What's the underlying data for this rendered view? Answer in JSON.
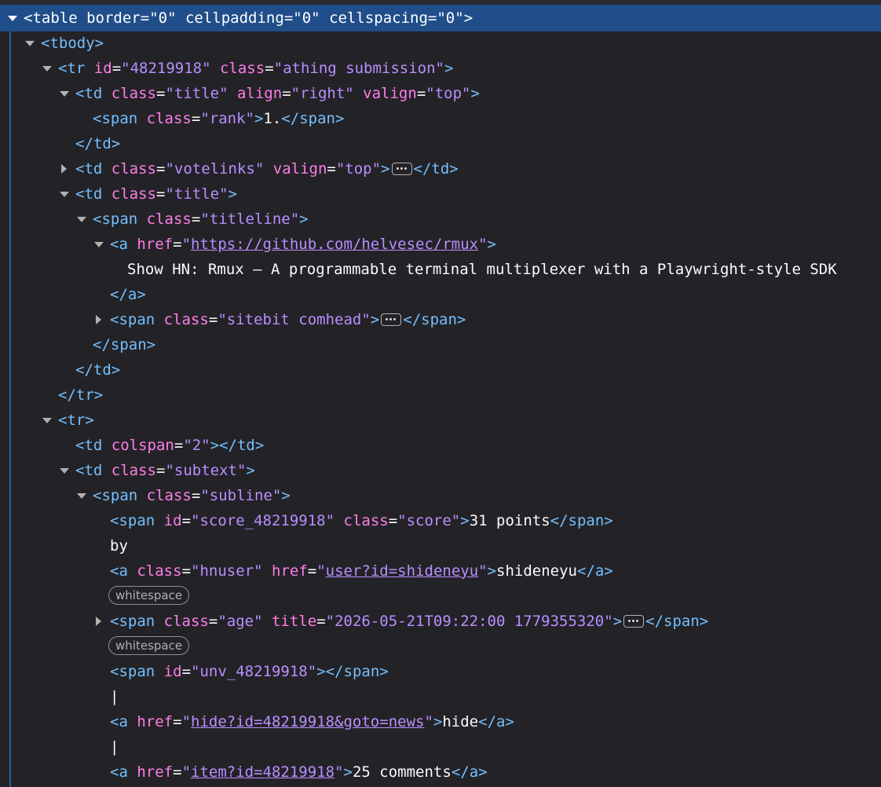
{
  "markup": {
    "table_tag": "table",
    "tbody_tag": "tbody",
    "tr_tag": "tr",
    "td_tag": "td",
    "span_tag": "span",
    "a_tag": "a",
    "border_attr": "border",
    "cellpadding_attr": "cellpadding",
    "cellspacing_attr": "cellspacing",
    "zero_val": "\"0\"",
    "id_attr": "id",
    "class_attr": "class",
    "align_attr": "align",
    "valign_attr": "valign",
    "href_attr": "href",
    "colspan_attr": "colspan",
    "title_attr": "title",
    "tr_id_val": "\"48219918\"",
    "athing_val": "\"athing submission\"",
    "title_val": "\"title\"",
    "right_val": "\"right\"",
    "top_val": "\"top\"",
    "rank_val": "\"rank\"",
    "rank_text": "1.",
    "votelinks_val": "\"votelinks\"",
    "titleline_val": "\"titleline\"",
    "github_href": "https://github.com/helvesec/rmux",
    "story_title": "Show HN: Rmux – A programmable terminal multiplexer with a Playwright-style SDK",
    "sitebit_val": "\"sitebit comhead\"",
    "colspan_val": "\"2\"",
    "subtext_val": "\"subtext\"",
    "subline_val": "\"subline\"",
    "score_id_val": "\"score_48219918\"",
    "score_val": "\"score\"",
    "points_text": "31 points",
    "by_text": "by",
    "hnuser_val": "\"hnuser\"",
    "user_href": "user?id=shideneyu",
    "username": "shideneyu",
    "whitespace_badge": "whitespace",
    "age_val": "\"age\"",
    "age_title_val": "\"2026-05-21T09:22:00 1779355320\"",
    "unv_id_val": "\"unv_48219918\"",
    "pipe": "|",
    "hide_href": "hide?id=48219918&goto=news",
    "hide_text": "hide",
    "item_href": "item?id=48219918",
    "comments_text": "25 comments"
  },
  "colors": {
    "background": "#232327",
    "selection": "#204e8a",
    "tag": "#75bfff",
    "attribute": "#ff7de9",
    "value": "#b98eff",
    "text": "#fbfbfe"
  },
  "icons": [
    "expand-twisty-icon",
    "collapse-twisty-icon",
    "ellipsis-icon"
  ]
}
